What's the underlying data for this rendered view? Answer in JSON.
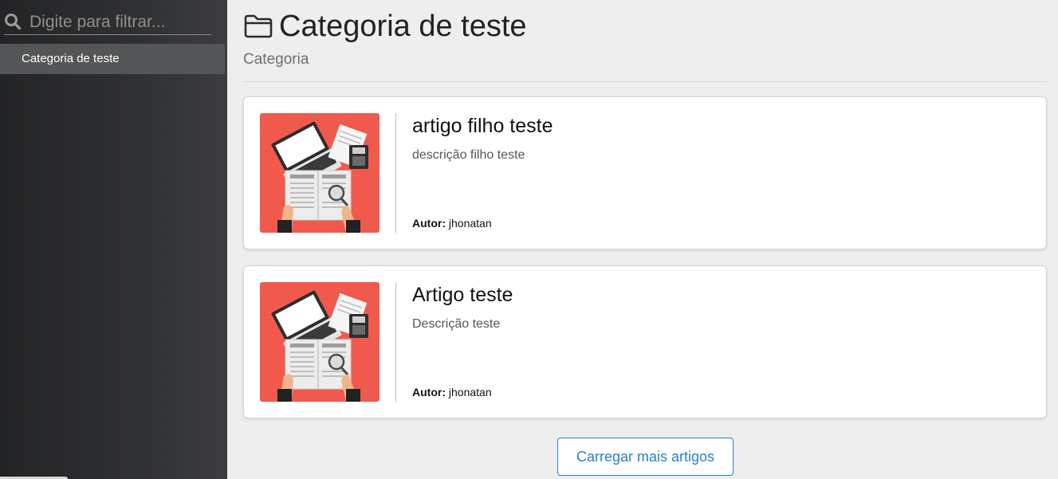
{
  "sidebar": {
    "search": {
      "placeholder": "Digite para filtrar...",
      "value": ""
    },
    "items": [
      {
        "label": "Categoria de teste",
        "active": true
      }
    ]
  },
  "header": {
    "title": "Categoria de teste",
    "subtitle": "Categoria",
    "icon": "folder-open-icon"
  },
  "articles": [
    {
      "title": "artigo filho teste",
      "description": "descrição filho teste",
      "author_label": "Autor:",
      "author": "jhonatan",
      "thumbnail": "newspaper-laptop-illustration"
    },
    {
      "title": "Artigo teste",
      "description": "Descrição teste",
      "author_label": "Autor:",
      "author": "jhonatan",
      "thumbnail": "newspaper-laptop-illustration"
    }
  ],
  "actions": {
    "load_more_label": "Carregar mais artigos"
  },
  "colors": {
    "sidebar_bg": "#2f3032",
    "sidebar_active": "#545556",
    "main_bg": "#eeeeee",
    "accent": "#2a7ed1",
    "thumb_bg": "#ef5a4c"
  }
}
